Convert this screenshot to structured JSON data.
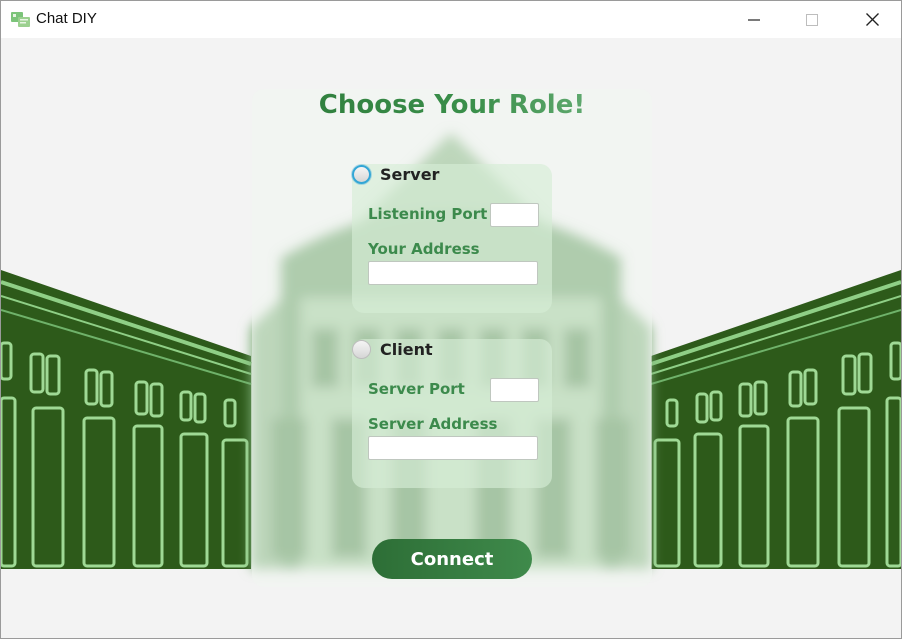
{
  "window": {
    "title": "Chat DIY",
    "controls": [
      "minimize",
      "maximize",
      "close"
    ]
  },
  "form": {
    "heading": "Choose Your Role!",
    "server": {
      "radio_label": "Server",
      "selected": false,
      "listening_port_label": "Listening Port",
      "listening_port_value": "",
      "your_address_label": "Your Address",
      "your_address_value": ""
    },
    "client": {
      "radio_label": "Client",
      "selected": false,
      "server_port_label": "Server Port",
      "server_port_value": "",
      "server_address_label": "Server Address",
      "server_address_value": ""
    },
    "connect_label": "Connect"
  },
  "colors": {
    "accent_green": "#3c8a4c",
    "dark_green": "#2a5a1c",
    "light_green": "#a6d8a0",
    "focus_blue": "#33a6d6"
  }
}
